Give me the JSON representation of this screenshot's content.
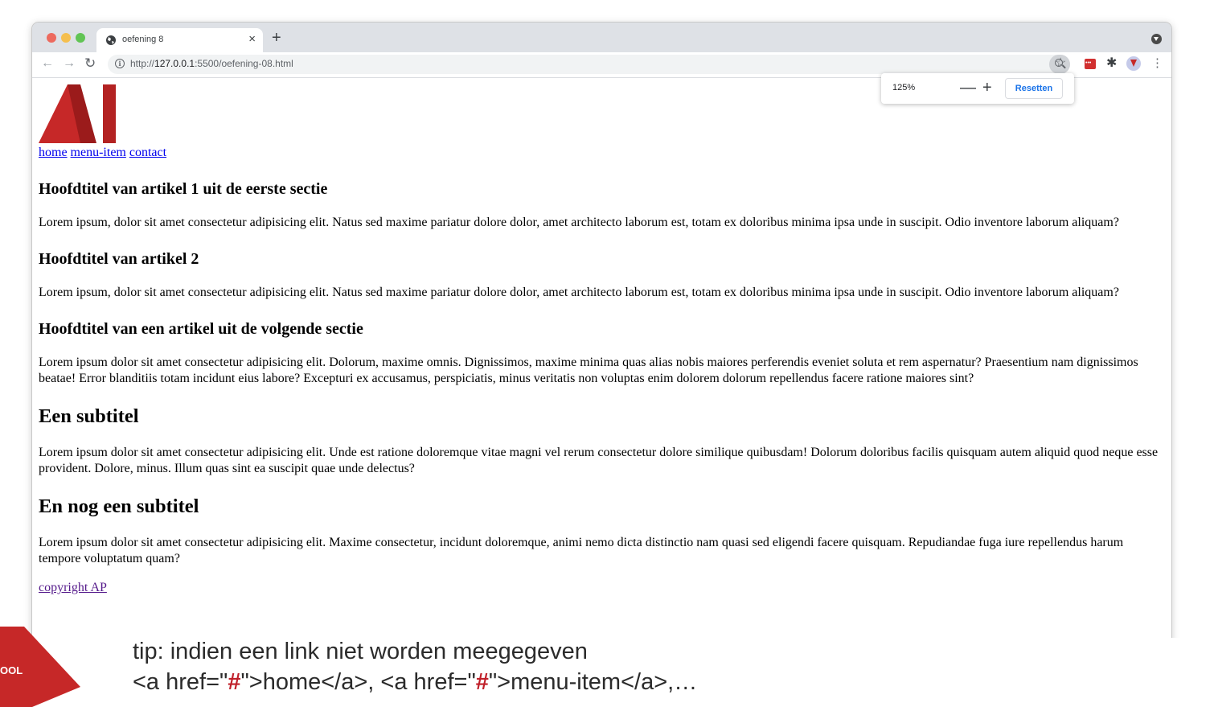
{
  "browser": {
    "tab_title": "oefening 8",
    "tab_close": "×",
    "new_tab": "+",
    "back": "←",
    "forward": "→",
    "reload": "↻",
    "url_prefix": "http://",
    "url_host": "127.0.0.1",
    "url_rest": ":5500/oefening-08.html",
    "star": "☆",
    "menu": "⋮",
    "puzzle": "✱"
  },
  "zoom_popup": {
    "level": "125%",
    "minus": "—",
    "plus": "+",
    "reset_label": "Resetten"
  },
  "page": {
    "nav": [
      "home",
      "menu-item",
      "contact"
    ],
    "sections": [
      {
        "heading": "Hoofdtitel van artikel 1 uit de eerste sectie",
        "text": "Lorem ipsum, dolor sit amet consectetur adipisicing elit. Natus sed maxime pariatur dolore dolor, amet architecto laborum est, totam ex doloribus minima ipsa unde in suscipit. Odio inventore laborum aliquam?"
      },
      {
        "heading": "Hoofdtitel van artikel 2",
        "text": "Lorem ipsum, dolor sit amet consectetur adipisicing elit. Natus sed maxime pariatur dolore dolor, amet architecto laborum est, totam ex doloribus minima ipsa unde in suscipit. Odio inventore laborum aliquam?"
      },
      {
        "heading": "Hoofdtitel van een artikel uit de volgende sectie",
        "text": "Lorem ipsum dolor sit amet consectetur adipisicing elit. Dolorum, maxime omnis. Dignissimos, maxime minima quas alias nobis maiores perferendis eveniet soluta et rem aspernatur? Praesentium nam dignissimos beatae! Error blanditiis totam incidunt eius labore? Excepturi ex accusamus, perspiciatis, minus veritatis non voluptas enim dolorem dolorum repellendus facere ratione maiores sint?"
      },
      {
        "heading": "Een subtitel",
        "text": "Lorem ipsum dolor sit amet consectetur adipisicing elit. Unde est ratione doloremque vitae magni vel rerum consectetur dolore similique quibusdam! Dolorum doloribus facilis quisquam autem aliquid quod neque esse provident. Dolore, minus. Illum quas sint ea suscipit quae unde delectus?"
      },
      {
        "heading": "En nog een subtitel",
        "text": "Lorem ipsum dolor sit amet consectetur adipisicing elit. Maxime consectetur, incidunt doloremque, animi nemo dicta distinctio nam quasi sed eligendi facere quisquam. Repudiandae fuga iure repellendus harum tempore voluptatum quam?"
      }
    ],
    "footer_link": "copyright AP"
  },
  "slide": {
    "corner_text": "OOL",
    "tip_line1": "tip: indien een link niet worden meegegeven",
    "tip_line2_parts": [
      "<a href=\"",
      "#",
      "\">home</a>, <a href=\"",
      "#",
      "\">menu-item</a>,…"
    ]
  },
  "colors": {
    "ap_red": "#c62828",
    "ap_dark_red": "#9b1b1b",
    "tip_hash": "#c0202a",
    "link_blue": "#0000ee",
    "link_visited": "#551a8b"
  },
  "icons": {
    "tab_favicon": "globe-icon",
    "info": "info-icon",
    "zoom": "zoom-magnifier-icon",
    "bookmark": "star-icon",
    "extension_red": "extension-icon",
    "extensions": "puzzle-icon",
    "profile_ext": "avatar-icon",
    "menu": "kebab-menu-icon",
    "browser_profile": "profile-down-icon"
  }
}
